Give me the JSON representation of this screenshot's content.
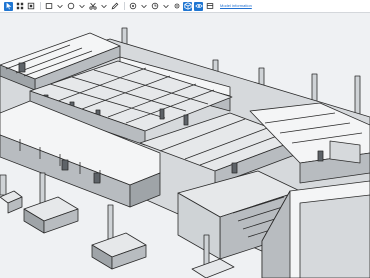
{
  "toolbar": {
    "tools": [
      {
        "name": "select-icon",
        "active": true
      },
      {
        "name": "grid-icon",
        "active": false
      },
      {
        "name": "frame-icon",
        "active": false
      },
      {
        "name": "rectangle-icon",
        "active": false
      },
      {
        "name": "circle-icon",
        "active": false
      },
      {
        "name": "scissors-icon",
        "active": false
      },
      {
        "name": "pen-icon",
        "active": false
      },
      {
        "name": "target-icon",
        "active": false
      },
      {
        "name": "clock-icon",
        "active": false
      },
      {
        "name": "cube-icon",
        "active": true
      },
      {
        "name": "eye-icon",
        "active": true
      },
      {
        "name": "layers-icon",
        "active": false
      }
    ],
    "link_label": "Model information"
  },
  "colors": {
    "accent": "#1f76d2",
    "wall_top": "#f4f5f6",
    "wall_side": "#b8bcc0",
    "floor": "#d6d9dc",
    "outline": "#2b2b2b"
  }
}
